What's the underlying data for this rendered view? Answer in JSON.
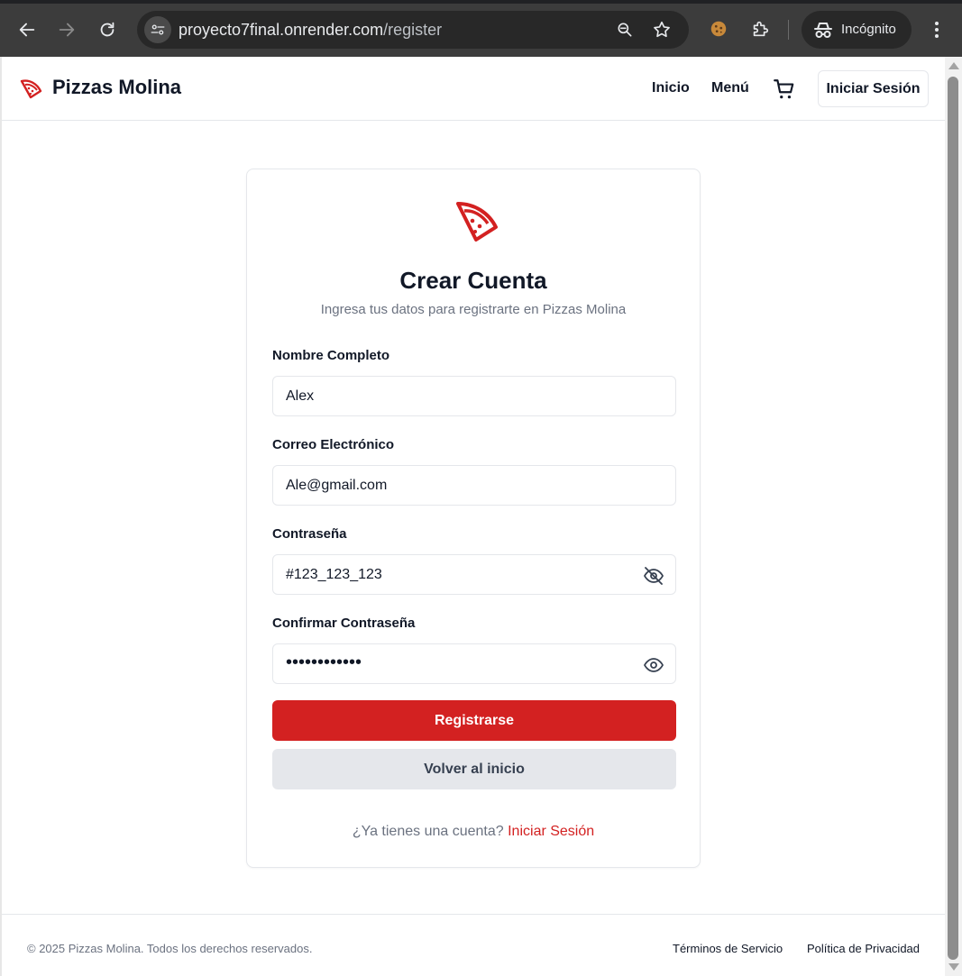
{
  "browser": {
    "url_host": "proyecto7final.onrender.com",
    "url_path": "/register",
    "incognito_label": "Incógnito",
    "icons": [
      "back-icon",
      "forward-icon",
      "reload-icon",
      "site-settings-icon",
      "zoom-icon",
      "bookmark-star-icon",
      "cookie-extension-icon",
      "extensions-icon",
      "incognito-icon",
      "menu-icon"
    ]
  },
  "header": {
    "brand": "Pizzas Molina",
    "nav": [
      "Inicio",
      "Menú"
    ],
    "login_label": "Iniciar Sesión"
  },
  "form": {
    "title": "Crear Cuenta",
    "subtitle": "Ingresa tus datos para registrarte en Pizzas Molina",
    "name_label": "Nombre Completo",
    "name_value": "Alex",
    "email_label": "Correo Electrónico",
    "email_value": "Ale@gmail.com",
    "password_label": "Contraseña",
    "password_value": "#123_123_123",
    "confirm_label": "Confirmar Contraseña",
    "confirm_value": "••••••••••••",
    "submit_label": "Registrarse",
    "back_label": "Volver al inicio",
    "have_account": "¿Ya tienes una cuenta?",
    "signin_link": "Iniciar Sesión"
  },
  "footer": {
    "copyright": "© 2025 Pizzas Molina. Todos los derechos reservados.",
    "terms": "Términos de Servicio",
    "privacy": "Política de Privacidad"
  },
  "colors": {
    "accent": "#d32121",
    "chrome": "#3c3c3c"
  }
}
